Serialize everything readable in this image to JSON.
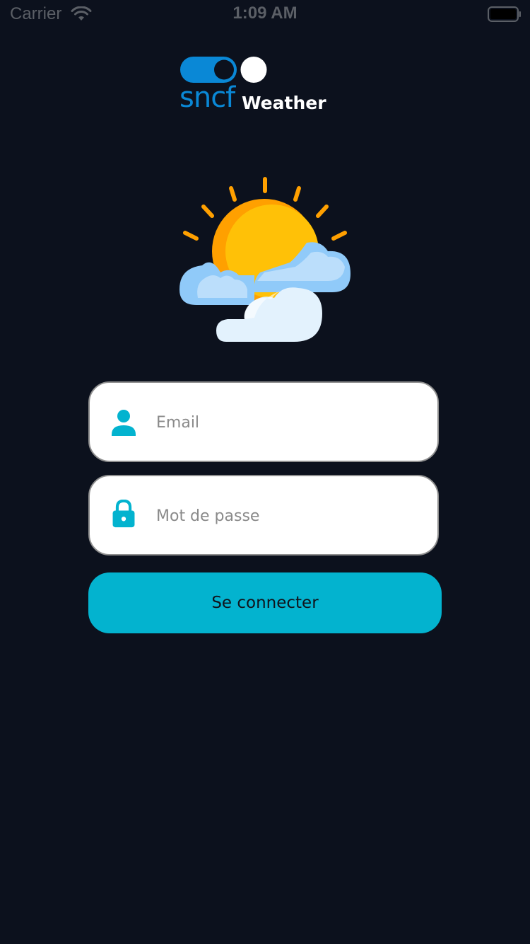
{
  "status_bar": {
    "carrier": "Carrier",
    "time": "1:09 AM"
  },
  "logo": {
    "brand": "sncf",
    "app_name": "Weather",
    "brand_color": "#0a88d6"
  },
  "illustration": {
    "icon": "sun-behind-clouds-icon"
  },
  "login_form": {
    "email": {
      "placeholder": "Email",
      "value": "",
      "icon": "user-icon"
    },
    "password": {
      "placeholder": "Mot de passe",
      "value": "",
      "icon": "lock-icon"
    },
    "submit_label": "Se connecter"
  },
  "colors": {
    "background": "#0c111d",
    "accent": "#03b3cf",
    "field_background": "#ffffff",
    "sun": "#ffc107",
    "sun_shade": "#ffa000",
    "cloud": "#90caf9",
    "cloud_light": "#e3f2fd"
  }
}
